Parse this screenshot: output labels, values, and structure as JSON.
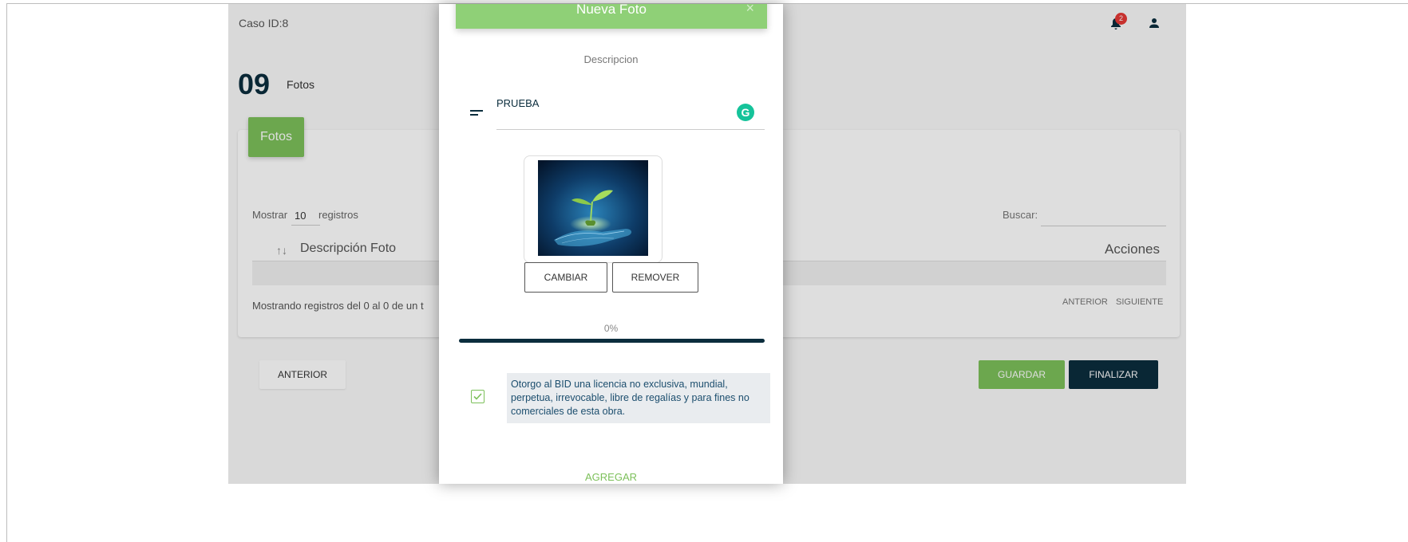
{
  "header": {
    "case_id": "Caso ID:8",
    "notifications_count": "2"
  },
  "step": {
    "number": "09",
    "label": "Fotos"
  },
  "card": {
    "tab_label": "Fotos",
    "show_label": "Mostrar",
    "show_value": "10",
    "show_suffix": "registros",
    "search_label": "Buscar:",
    "search_value": "",
    "columns": {
      "sort_icon": "↑↓",
      "description": "Descripción Foto",
      "actions": "Acciones"
    },
    "info": "Mostrando registros del 0 al 0 de un t",
    "pagination": {
      "prev": "ANTERIOR",
      "next": "SIGUIENTE"
    }
  },
  "footer": {
    "back": "ANTERIOR",
    "save": "GUARDAR",
    "finish": "FINALIZAR"
  },
  "modal": {
    "title": "Nueva Foto",
    "close": "×",
    "description_label": "Descripcion",
    "description_value": "PRUEBA",
    "change_button": "CAMBIAR",
    "remove_button": "REMOVER",
    "progress_text": "0%",
    "progress_value": 0,
    "license_checked": true,
    "license_text": "Otorgo al BID una licencia no exclusiva, mundial, perpetua, irrevocable, libre de regalías y para fines no comerciales de esta obra.",
    "add_button": "AGREGAR"
  },
  "colors": {
    "accent": "#7cc05a",
    "dark": "#0b2d3d",
    "badge": "#e53935",
    "grammarly": "#15c39a"
  }
}
